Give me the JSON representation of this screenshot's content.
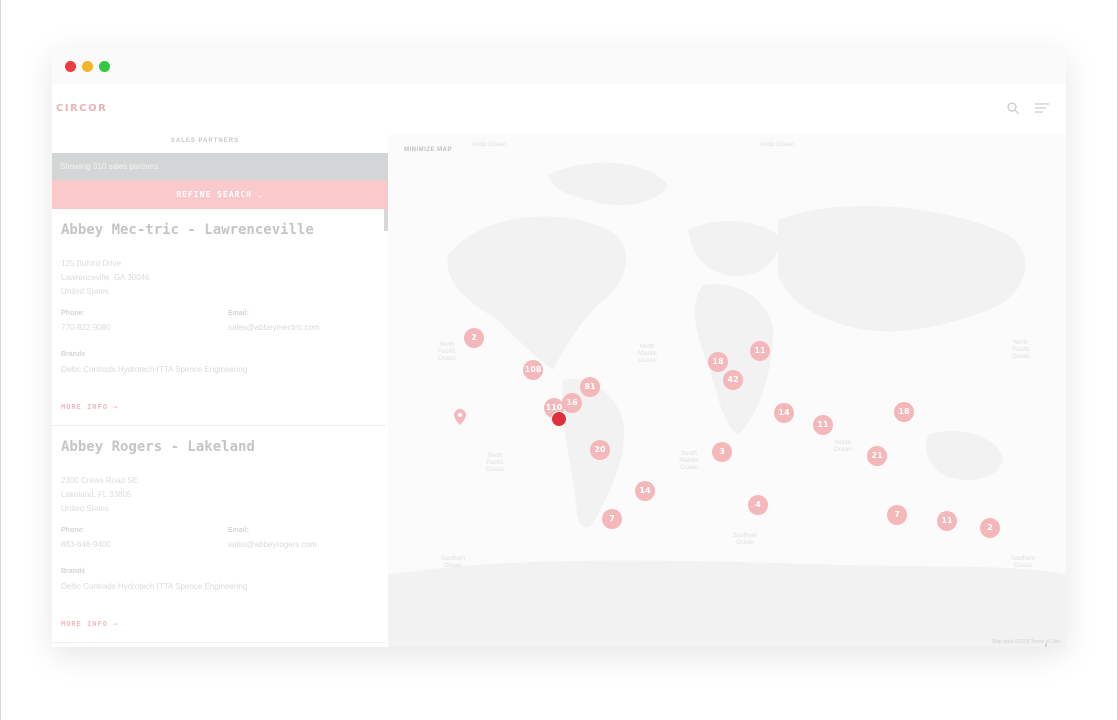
{
  "header": {
    "logo": "CIRCOR",
    "icons": [
      "search-icon",
      "menu-icon"
    ]
  },
  "sidebar": {
    "title": "SALES PARTNERS",
    "showing": "Showing 310 sales partners",
    "refine": "REFINE SEARCH",
    "partners": [
      {
        "name": "Abbey Mec-tric - Lawrenceville",
        "address": [
          "125 Buford Drive",
          "Lawrenceville, GA 30046",
          "United States"
        ],
        "phone_label": "Phone:",
        "phone": "770-822-9080",
        "email_label": "Email:",
        "email": "sales@abbeymectric.com",
        "brands_label": "Brands",
        "brands": "Deltic Contrads  Hydrotech  ITTA  Spence Engineering",
        "more": "MORE INFO"
      },
      {
        "name": "Abbey Rogers - Lakeland",
        "address": [
          "2300 Crews Road SE",
          "Lakeland, FL 33805",
          "United States"
        ],
        "phone_label": "Phone:",
        "phone": "863-646-9400",
        "email_label": "Email:",
        "email": "sales@abbeyrogers.com",
        "brands_label": "Brands",
        "brands": "Deltic Contrads  Hydrotech  ITTA  Spence Engineering",
        "more": "MORE INFO"
      }
    ]
  },
  "map": {
    "minimize": "MINIMIZE MAP",
    "zoom_in": "+",
    "zoom_out": "−",
    "attribution": "Map data ©2019   Terms of Use",
    "ocean_labels": [
      "Arctic Ocean",
      "Arctic Ocean",
      "North Pacific Ocean",
      "North Atlantic Ocean",
      "South Pacific Ocean",
      "South Atlantic Ocean",
      "Indian Ocean",
      "North Pacific Ocean",
      "Southern Ocean",
      "Southern Ocean",
      "Southern Ocean"
    ],
    "clusters": [
      "2",
      "108",
      "81",
      "16",
      "110",
      "20",
      "14",
      "7",
      "18",
      "11",
      "42",
      "14",
      "11",
      "18",
      "3",
      "21",
      "4",
      "7",
      "11",
      "2"
    ],
    "colors": {
      "cluster": "#f4b7ba",
      "selected": "#e0303b",
      "accent": "#f9c9cc"
    }
  }
}
